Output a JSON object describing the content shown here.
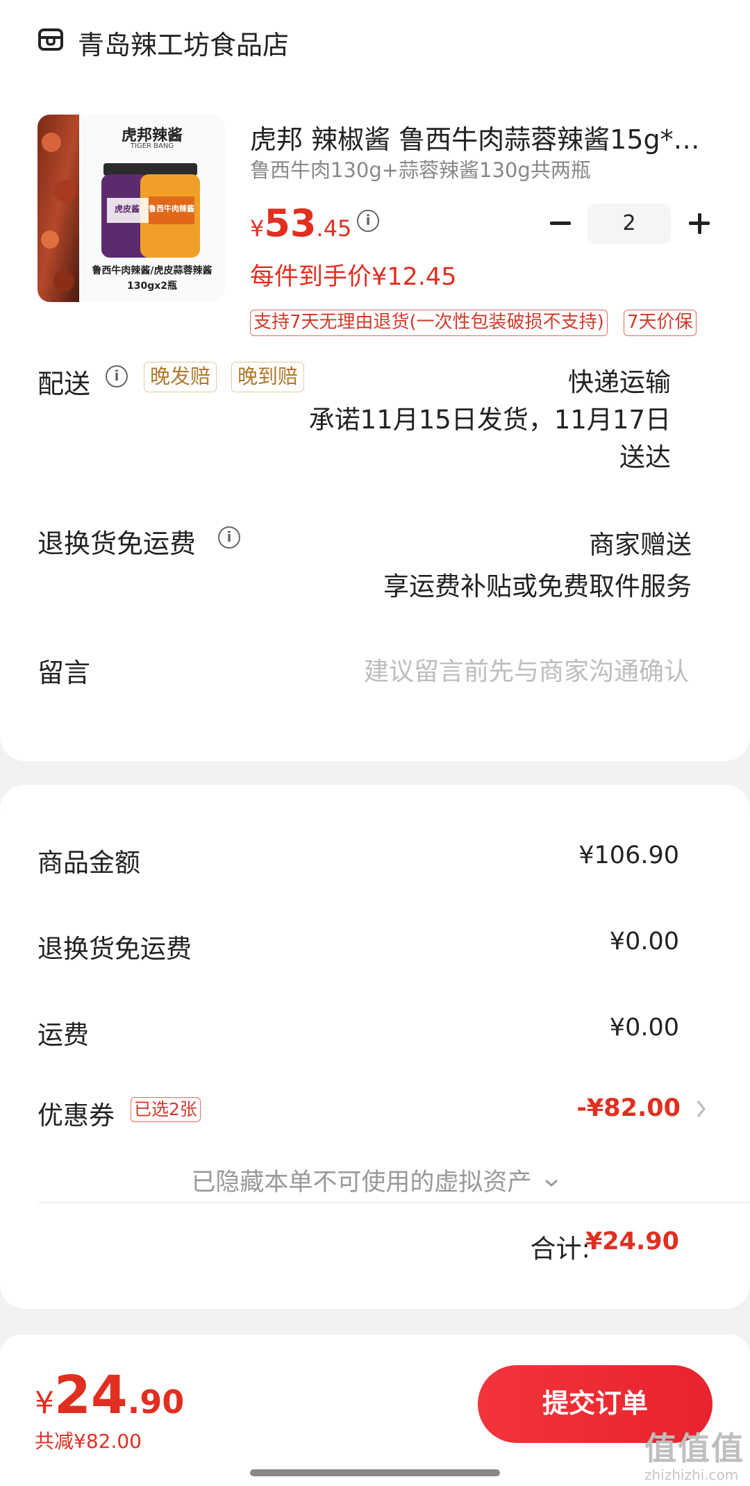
{
  "store": {
    "icon": "store-icon",
    "name": "青岛辣工坊食品店"
  },
  "product": {
    "image_brand": "虎邦辣酱",
    "image_brand_en": "TIGER BANG",
    "image_jar_left": "虎皮酱",
    "image_jar_right": "鲁西牛肉辣酱",
    "image_caption_line1": "鲁西牛肉辣酱/虎皮蒜蓉辣酱",
    "image_caption_line2": "130gx2瓶",
    "title": "虎邦 辣椒酱 鲁西牛肉蒜蓉辣酱15g*1…",
    "spec": "鲁西牛肉130g+蒜蓉辣酱130g共两瓶",
    "price_currency": "¥",
    "price_int": "53",
    "price_dec": ".45",
    "unit_price": "每件到手价¥12.45",
    "quantity": "2",
    "tags": [
      "支持7天无理由退货(一次性包装破损不支持)",
      "7天价保"
    ]
  },
  "delivery": {
    "label": "配送",
    "badges": [
      "晚发赔",
      "晚到赔"
    ],
    "method": "快递运输",
    "promise_line1": "承诺11月15日发货，11月17日",
    "promise_line2": "送达"
  },
  "return_shipping": {
    "label": "退换货免运费",
    "value_line1": "商家赠送",
    "value_line2": "享运费补贴或免费取件服务"
  },
  "message": {
    "label": "留言",
    "placeholder": "建议留言前先与商家沟通确认"
  },
  "summary": {
    "goods_label": "商品金额",
    "goods_value": "¥106.90",
    "return_label": "退换货免运费",
    "return_value": "¥0.00",
    "shipping_label": "运费",
    "shipping_value": "¥0.00",
    "coupon_label": "优惠券",
    "coupon_badge": "已选2张",
    "coupon_value": "-¥82.00",
    "hidden_assets": "已隐藏本单不可使用的虚拟资产",
    "total_label": "合计:",
    "total_value": "¥24.90"
  },
  "bottom": {
    "currency": "¥",
    "total_int": "24",
    "total_dec": ".90",
    "discount": "共减¥82.00",
    "submit_label": "提交订单",
    "watermark": "值值值",
    "watermark_url": "zhizhizhi.com"
  },
  "colors": {
    "accent_red": "#e02f20",
    "button_red": "#f2343c",
    "badge_gold": "#b07a2c",
    "background": "#f2f2f2"
  }
}
